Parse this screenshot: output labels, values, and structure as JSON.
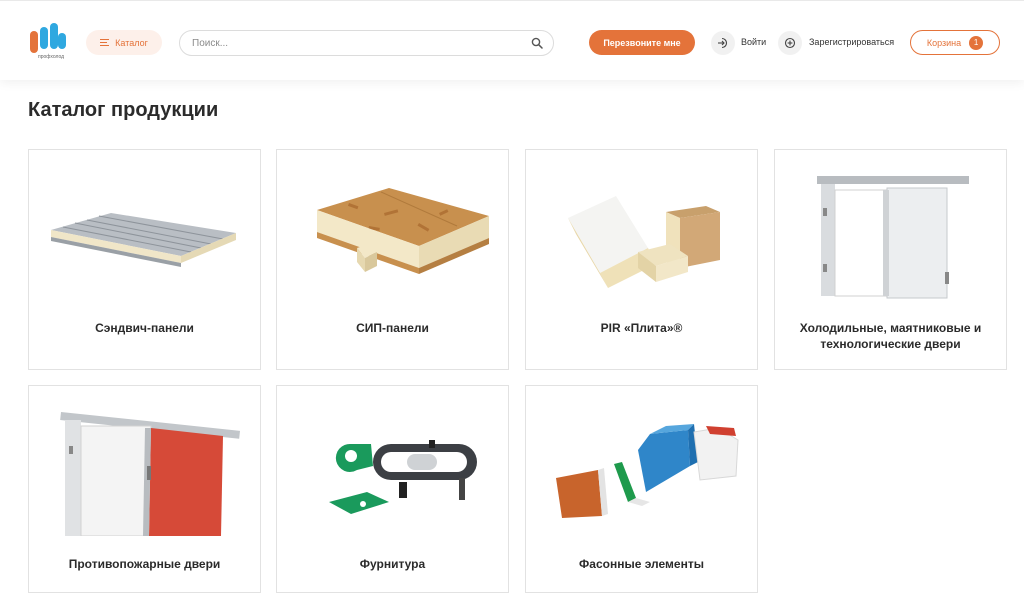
{
  "header": {
    "logo_text": "профхолод",
    "catalog_label": "Каталог",
    "search_placeholder": "Поиск...",
    "callback_label": "Перезвоните мне",
    "login_label": "Войти",
    "register_label": "Зарегистрироваться",
    "cart_label": "Корзина",
    "cart_count": "1"
  },
  "page": {
    "title": "Каталог продукции"
  },
  "products": [
    {
      "name": "Сэндвич-панели",
      "icon": "sandwich-panel-image"
    },
    {
      "name": "СИП-панели",
      "icon": "sip-panel-image"
    },
    {
      "name": "PIR «Плита»®",
      "icon": "pir-plate-image"
    },
    {
      "name": "Холодильные, маятниковые и технологические двери",
      "icon": "cold-door-image"
    },
    {
      "name": "Противопожарные двери",
      "icon": "fire-door-image"
    },
    {
      "name": "Фурнитура",
      "icon": "hardware-image"
    },
    {
      "name": "Фасонные элементы",
      "icon": "flashing-elements-image"
    }
  ],
  "colors": {
    "accent": "#e4733a",
    "logo_blue": "#2fa8e0"
  }
}
